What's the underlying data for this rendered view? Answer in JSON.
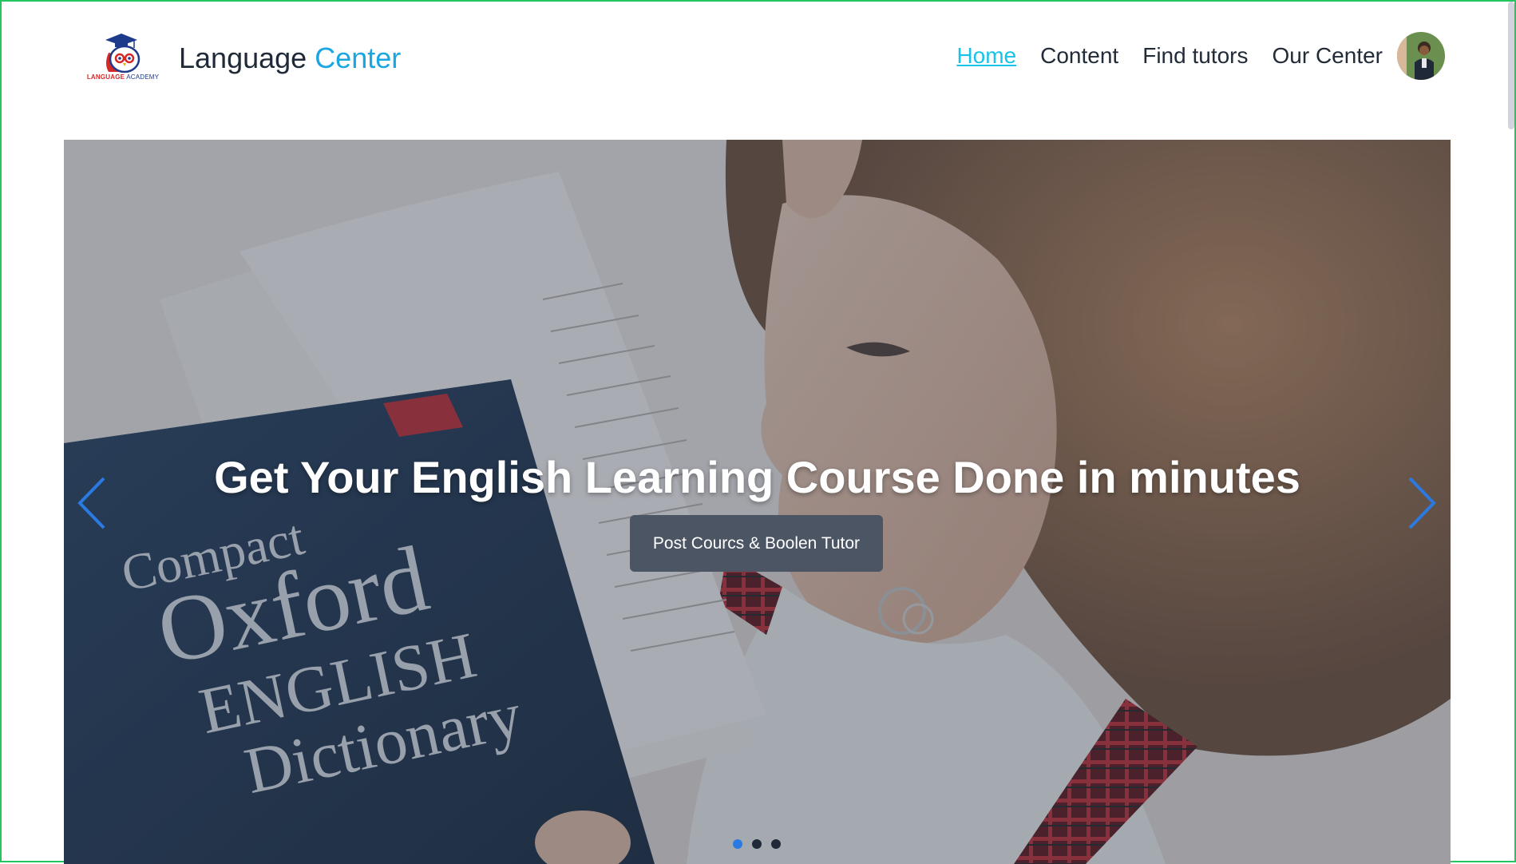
{
  "header": {
    "brand_primary": "Language",
    "brand_accent": "Center",
    "logo_text_red": "LANGUAGE",
    "logo_text_navy": "ACADEMY",
    "nav": [
      {
        "label": "Home",
        "active": true
      },
      {
        "label": "Content",
        "active": false
      },
      {
        "label": "Find tutors",
        "active": false
      },
      {
        "label": "Our Center",
        "active": false
      }
    ],
    "avatar_icon": "user-avatar"
  },
  "hero": {
    "title": "Get Your English Learning Course Done in minutes",
    "cta_label": "Post Courcs & Boolen Tutor",
    "book_text": [
      "Compact",
      "Oxford",
      "ENGLISH",
      "Dictionary"
    ],
    "prev_icon": "chevron-left-icon",
    "next_icon": "chevron-right-icon",
    "slides_count": 3,
    "active_slide": 1
  },
  "colors": {
    "accent": "#1aa6e0",
    "nav_active": "#17c3e8",
    "arrow": "#2a7ae2",
    "button_bg": "#4b5563",
    "frame_border": "#22c55e"
  }
}
